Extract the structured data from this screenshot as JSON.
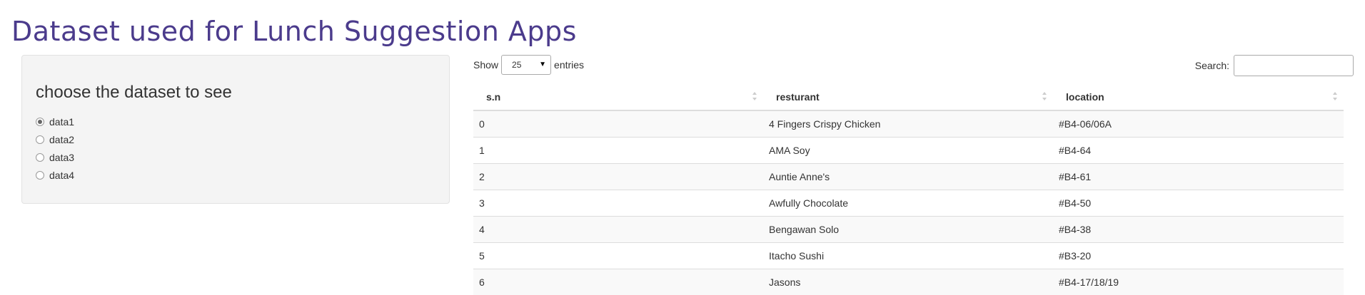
{
  "page": {
    "title": "Dataset used for Lunch Suggestion Apps"
  },
  "sidebar": {
    "heading": "choose the dataset to see",
    "options": [
      {
        "label": "data1",
        "checked": true
      },
      {
        "label": "data2",
        "checked": false
      },
      {
        "label": "data3",
        "checked": false
      },
      {
        "label": "data4",
        "checked": false
      }
    ]
  },
  "table_controls": {
    "show_label": "Show",
    "entries_value": "25",
    "entries_label": "entries",
    "search_label": "Search:",
    "search_value": ""
  },
  "table": {
    "columns": [
      "s.n",
      "resturant",
      "location"
    ],
    "rows": [
      [
        "0",
        "4 Fingers Crispy Chicken",
        "#B4-06/06A"
      ],
      [
        "1",
        "AMA Soy",
        "#B4-64"
      ],
      [
        "2",
        "Auntie Anne's",
        "#B4-61"
      ],
      [
        "3",
        "Awfully Chocolate",
        "#B4-50"
      ],
      [
        "4",
        "Bengawan Solo",
        "#B4-38"
      ],
      [
        "5",
        "Itacho Sushi",
        "#B3-20"
      ],
      [
        "6",
        "Jasons",
        "#B4-17/18/19"
      ]
    ]
  },
  "icons": {
    "sort": "sort-both-icon",
    "dropdown": "chevron-down-icon"
  },
  "colors": {
    "title": "#4b3b8c",
    "panel_bg": "#f4f4f4",
    "stripe": "#f9f9f9"
  }
}
